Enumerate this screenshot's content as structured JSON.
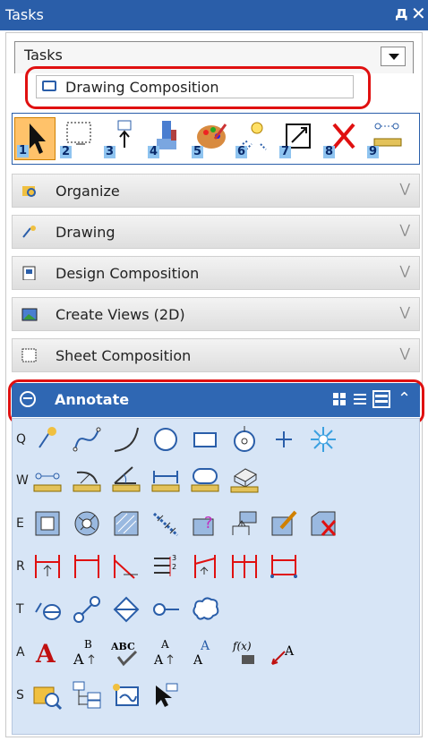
{
  "window": {
    "title": "Tasks",
    "pin_glyph": "д",
    "close_glyph": "✕"
  },
  "tasks_combo": {
    "label": "Tasks"
  },
  "task_item": {
    "label": "Drawing Composition"
  },
  "toolbar": {
    "tools": [
      "1",
      "2",
      "3",
      "4",
      "5",
      "6",
      "7",
      "8",
      "9"
    ]
  },
  "sections": [
    {
      "label": "Organize"
    },
    {
      "label": "Drawing"
    },
    {
      "label": "Design Composition"
    },
    {
      "label": "Create Views (2D)"
    },
    {
      "label": "Sheet Composition"
    }
  ],
  "annotate": {
    "label": "Annotate"
  },
  "rows": [
    {
      "key": "Q"
    },
    {
      "key": "W"
    },
    {
      "key": "E"
    },
    {
      "key": "R"
    },
    {
      "key": "T"
    },
    {
      "key": "A"
    },
    {
      "key": "S"
    }
  ],
  "colors": {
    "accent": "#2a5ea9",
    "highlight": "#e01010",
    "tool_bg": "#d7e5f6"
  }
}
